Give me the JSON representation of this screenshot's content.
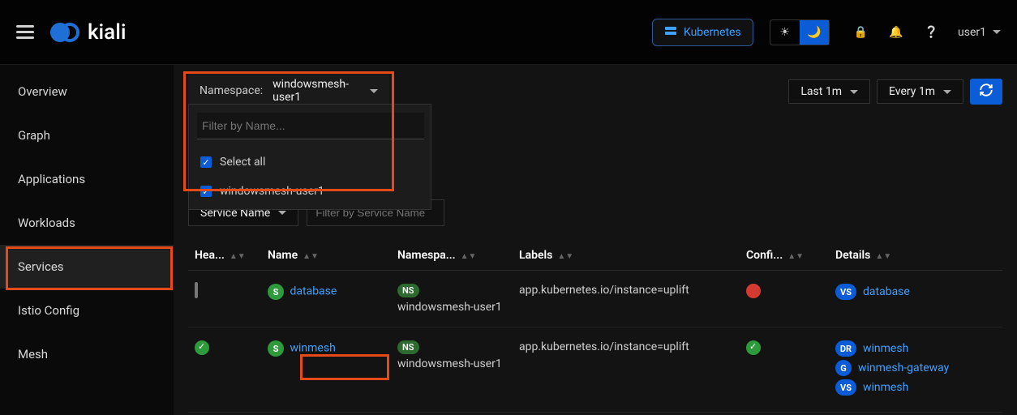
{
  "brand": "kiali",
  "clusterPill": "Kubernetes",
  "user": "user1",
  "sidebar": {
    "items": [
      "Overview",
      "Graph",
      "Applications",
      "Workloads",
      "Services",
      "Istio Config",
      "Mesh"
    ],
    "activeIndex": 4
  },
  "ns": {
    "label": "Namespace:",
    "value": "windowsmesh-user1",
    "filterPlaceholder": "Filter by Name...",
    "selectAll": "Select all",
    "options": [
      "windowsmesh-user1"
    ]
  },
  "refresh": {
    "range": "Last 1m",
    "interval": "Every 1m"
  },
  "filter": {
    "type": "Service Name",
    "placeholder": "Filter by Service Name"
  },
  "columns": [
    "Hea...",
    "Name",
    "Namespa...",
    "Labels",
    "Confi...",
    "Details"
  ],
  "rows": [
    {
      "health": "unknown",
      "name": "database",
      "namespace": "windowsmesh-user1",
      "label": "app.kubernetes.io/instance=uplift",
      "config": "error",
      "details": [
        {
          "badge": "VS",
          "text": "database"
        }
      ]
    },
    {
      "health": "ok",
      "name": "winmesh",
      "namespace": "windowsmesh-user1",
      "label": "app.kubernetes.io/instance=uplift",
      "config": "ok",
      "details": [
        {
          "badge": "DR",
          "text": "winmesh"
        },
        {
          "badge": "G",
          "text": "winmesh-gateway"
        },
        {
          "badge": "VS",
          "text": "winmesh"
        }
      ]
    }
  ]
}
